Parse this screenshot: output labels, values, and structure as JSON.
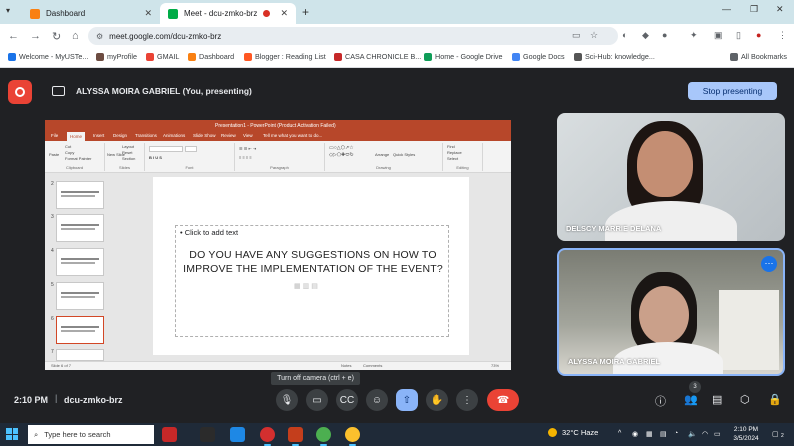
{
  "browser": {
    "tabs": [
      {
        "title": "Dashboard",
        "active": false,
        "icon": "moodle-icon"
      },
      {
        "title": "Meet - dcu-zmko-brz",
        "active": true,
        "icon": "meet-icon",
        "recording": true
      }
    ],
    "url": "meet.google.com/dcu-zmko-brz",
    "bookmarks": [
      {
        "label": "Welcome - MyUSTe..."
      },
      {
        "label": "myProfile"
      },
      {
        "label": "GMAIL"
      },
      {
        "label": "Dashboard"
      },
      {
        "label": "Blogger : Reading List"
      },
      {
        "label": "CASA CHRONICLE B..."
      },
      {
        "label": "Home - Google Drive"
      },
      {
        "label": "Google Docs"
      },
      {
        "label": "Sci-Hub: knowledge..."
      }
    ],
    "all_bookmarks_label": "All Bookmarks"
  },
  "meet": {
    "presenting_label": "ALYSSA MOIRA GABRIEL (You, presenting)",
    "stop_button": "Stop presenting",
    "participants": [
      {
        "name": "DELSCY MARRIE DELANA"
      },
      {
        "name": "ALYSSA MOIRA GABRIEL"
      }
    ],
    "participant_count": "3",
    "tooltip": "Turn off camera (ctrl + e)",
    "time": "2:10 PM",
    "separator": "|",
    "meeting_code": "dcu-zmko-brz",
    "colors": {
      "background": "#202124",
      "accent": "#a8c7fa",
      "end_call": "#ea4335"
    }
  },
  "presentation": {
    "window_title": "Presentation1 - PowerPoint (Product Activation Failed)",
    "ribbon_tabs": [
      "File",
      "Home",
      "Insert",
      "Design",
      "Transitions",
      "Animations",
      "Slide Show",
      "Review",
      "View",
      "Tell me what you want to do..."
    ],
    "ribbon_groups": [
      "Clipboard",
      "Slides",
      "Font",
      "Paragraph",
      "Drawing",
      "Editing"
    ],
    "ribbon_buttons": {
      "paste": "Paste",
      "cut": "Cut",
      "copy": "Copy",
      "format_painter": "Format Painter",
      "new_slide": "New Slide",
      "layout": "Layout",
      "reset": "Reset",
      "section": "Section",
      "arrange": "Arrange",
      "quick_styles": "Quick Styles",
      "find": "Find",
      "replace": "Replace",
      "select": "Select"
    },
    "thumbnail_numbers": [
      "2",
      "3",
      "4",
      "5",
      "6",
      "7"
    ],
    "slide_bullet": "Click to add text",
    "slide_question": "DO YOU HAVE ANY SUGGESTIONS ON HOW TO IMPROVE THE IMPLEMENTATION OF THE EVENT?",
    "status_left": "Slide 6 of 7",
    "status_notes": "Notes",
    "status_comments": "Comments",
    "status_zoom": "73%",
    "brand_color": "#b7472a"
  },
  "taskbar": {
    "search_placeholder": "Type here to search",
    "weather": "32°C  Haze",
    "time": "2:10 PM",
    "date": "3/5/2024",
    "notification_count": "2"
  }
}
